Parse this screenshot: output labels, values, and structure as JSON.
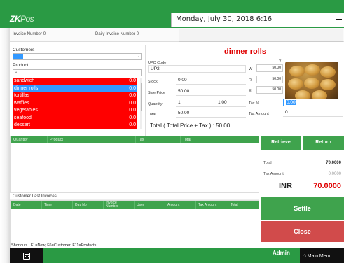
{
  "app": {
    "logo_main": "ZK",
    "logo_sub": "Pos",
    "datetime": "Monday, July 30, 2018 6:16"
  },
  "invoice": {
    "invoice_number_label": "Invoice Number",
    "invoice_number": "0",
    "daily_invoice_label": "Daily Invoice Number",
    "daily_invoice_number": "0"
  },
  "customers": {
    "label": "Customers",
    "selected": ""
  },
  "product_search": {
    "label": "Product",
    "value": "s"
  },
  "products": [
    {
      "name": "sandwich",
      "price": "0.0",
      "selected": false
    },
    {
      "name": "dinner rolls",
      "price": "0.0",
      "selected": true
    },
    {
      "name": "tortillas",
      "price": "0.0",
      "selected": false
    },
    {
      "name": "waffles",
      "price": "0.0",
      "selected": false
    },
    {
      "name": "vegetables",
      "price": "0.0",
      "selected": false
    },
    {
      "name": "seafood",
      "price": "0.0",
      "selected": false
    },
    {
      "name": "dessert",
      "price": "0.0",
      "selected": false
    }
  ],
  "detail": {
    "title": "dinner rolls",
    "upc_label": "UPC Code",
    "upc_value": "UP2",
    "stock_label": "Stock",
    "stock_value": "0.00",
    "sale_price_label": "Sale Price",
    "sale_price_value": "50.00",
    "quantity_label": "Quantity",
    "quantity_value": "1",
    "quantity_unit": "1.00",
    "total_label": "Total",
    "total_value": "50.00",
    "w_label": "W",
    "w_value": "50.00",
    "r_label": "R",
    "r_value": "50.00",
    "e_label": "E",
    "e_value": "50.00",
    "tax_label": "Tax %",
    "tax_value": "0.00",
    "tax_amount_label": "Tax Amount",
    "tax_amount_value": "0",
    "v_label": "V",
    "summary": "Total ( Total Price + Tax ) : 50.00"
  },
  "order_grid": {
    "columns": [
      "Quantity",
      "Product",
      "Tax",
      "Total"
    ]
  },
  "totals": {
    "retrieve_label": "Retrieve",
    "return_label": "Return",
    "total_label": "Total",
    "total_value": "70.0000",
    "tax_amount_label": "Tax Amount",
    "tax_amount_value": "0.0000",
    "currency": "INR",
    "grand_total": "70.0000"
  },
  "last_invoices": {
    "title": "Customer Last Invoices",
    "columns": [
      "Date",
      "Time",
      "Day No",
      "Invoice Number",
      "User",
      "Amount",
      "Tax Amount",
      "Total"
    ]
  },
  "actions": {
    "settle_label": "Settle",
    "close_label": "Close"
  },
  "shortcuts": "Shortcuts : F1=New, F6=Customer, F11=Products",
  "footer": {
    "user": "Admin",
    "main_menu": "Main Menu",
    "home_glyph": "⌂"
  },
  "colors": {
    "brand_green": "#2a9a44",
    "header_green": "#3fa34d",
    "list_red": "#ff0000",
    "selected_blue": "#3399ff",
    "close_red": "#d14b4b",
    "title_red": "#e00000"
  },
  "icons": [
    "minimize-icon",
    "dropdown-arrow-icon",
    "scroll-up-icon",
    "scroll-down-icon",
    "calculator-icon",
    "home-icon"
  ]
}
